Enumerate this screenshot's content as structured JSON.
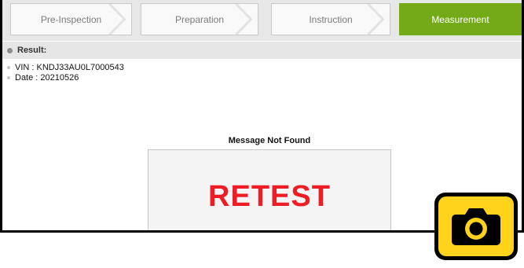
{
  "steps": [
    {
      "label": "Pre-Inspection",
      "active": false
    },
    {
      "label": "Preparation",
      "active": false
    },
    {
      "label": "Instruction",
      "active": false
    },
    {
      "label": "Measurement",
      "active": true
    }
  ],
  "result": {
    "label": "Result:",
    "vin": "VIN : KNDJ33AU0L7000543",
    "date": "Date : 20210526"
  },
  "message": {
    "title": "Message Not Found",
    "status": "RETEST"
  },
  "colors": {
    "accent_green": "#74aa18",
    "retest_red": "#ee1c25",
    "camera_yellow": "#ffd21c"
  },
  "icons": {
    "camera": "camera-icon"
  }
}
